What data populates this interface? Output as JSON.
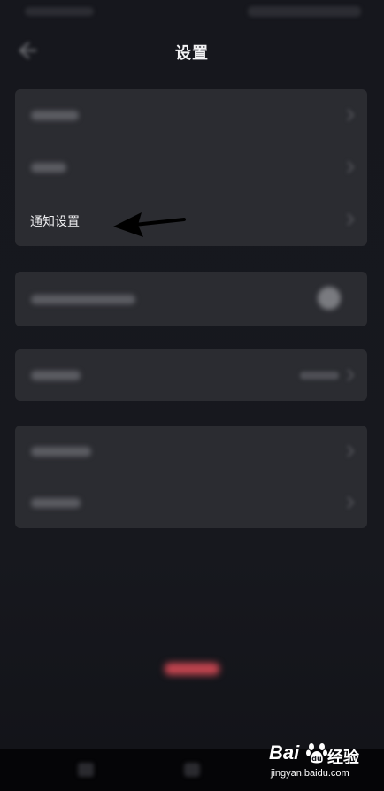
{
  "header": {
    "title": "设置"
  },
  "settings": {
    "notification_label": "通知设置"
  },
  "watermark": {
    "brand": "Bai",
    "brand_suffix": "经验",
    "url": "jingyan.baidu.com"
  },
  "colors": {
    "background": "#16171d",
    "card": "#2b2c31",
    "logout_accent": "#c2444f"
  }
}
